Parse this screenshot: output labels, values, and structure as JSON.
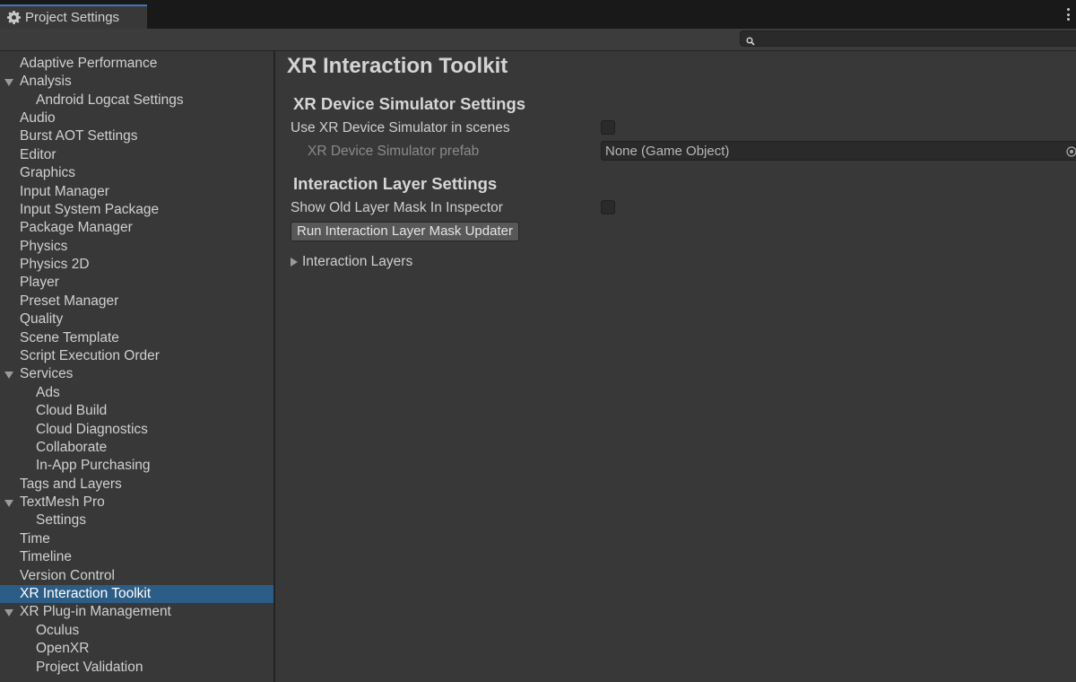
{
  "window": {
    "tab_title": "Project Settings"
  },
  "search": {
    "placeholder": "",
    "value": ""
  },
  "sidebar": {
    "items": [
      {
        "label": "Adaptive Performance",
        "level": 0,
        "expanded": null
      },
      {
        "label": "Analysis",
        "level": 0,
        "expanded": true
      },
      {
        "label": "Android Logcat Settings",
        "level": 1,
        "expanded": null
      },
      {
        "label": "Audio",
        "level": 0,
        "expanded": null
      },
      {
        "label": "Burst AOT Settings",
        "level": 0,
        "expanded": null
      },
      {
        "label": "Editor",
        "level": 0,
        "expanded": null
      },
      {
        "label": "Graphics",
        "level": 0,
        "expanded": null
      },
      {
        "label": "Input Manager",
        "level": 0,
        "expanded": null
      },
      {
        "label": "Input System Package",
        "level": 0,
        "expanded": null
      },
      {
        "label": "Package Manager",
        "level": 0,
        "expanded": null
      },
      {
        "label": "Physics",
        "level": 0,
        "expanded": null
      },
      {
        "label": "Physics 2D",
        "level": 0,
        "expanded": null
      },
      {
        "label": "Player",
        "level": 0,
        "expanded": null
      },
      {
        "label": "Preset Manager",
        "level": 0,
        "expanded": null
      },
      {
        "label": "Quality",
        "level": 0,
        "expanded": null
      },
      {
        "label": "Scene Template",
        "level": 0,
        "expanded": null
      },
      {
        "label": "Script Execution Order",
        "level": 0,
        "expanded": null
      },
      {
        "label": "Services",
        "level": 0,
        "expanded": true
      },
      {
        "label": "Ads",
        "level": 1,
        "expanded": null
      },
      {
        "label": "Cloud Build",
        "level": 1,
        "expanded": null
      },
      {
        "label": "Cloud Diagnostics",
        "level": 1,
        "expanded": null
      },
      {
        "label": "Collaborate",
        "level": 1,
        "expanded": null
      },
      {
        "label": "In-App Purchasing",
        "level": 1,
        "expanded": null
      },
      {
        "label": "Tags and Layers",
        "level": 0,
        "expanded": null
      },
      {
        "label": "TextMesh Pro",
        "level": 0,
        "expanded": true
      },
      {
        "label": "Settings",
        "level": 1,
        "expanded": null
      },
      {
        "label": "Time",
        "level": 0,
        "expanded": null
      },
      {
        "label": "Timeline",
        "level": 0,
        "expanded": null
      },
      {
        "label": "Version Control",
        "level": 0,
        "expanded": null
      },
      {
        "label": "XR Interaction Toolkit",
        "level": 0,
        "expanded": null,
        "selected": true
      },
      {
        "label": "XR Plug-in Management",
        "level": 0,
        "expanded": true
      },
      {
        "label": "Oculus",
        "level": 1,
        "expanded": null
      },
      {
        "label": "OpenXR",
        "level": 1,
        "expanded": null
      },
      {
        "label": "Project Validation",
        "level": 1,
        "expanded": null
      }
    ]
  },
  "main": {
    "title": "XR Interaction Toolkit",
    "device_simulator": {
      "heading": "XR Device Simulator Settings",
      "use_simulator_label": "Use XR Device Simulator in scenes",
      "use_simulator_checked": false,
      "prefab_label": "XR Device Simulator prefab",
      "prefab_value": "None (Game Object)"
    },
    "interaction_layer": {
      "heading": "Interaction Layer Settings",
      "show_old_mask_label": "Show Old Layer Mask In Inspector",
      "show_old_mask_checked": false,
      "updater_button_label": "Run Interaction Layer Mask Updater",
      "layers_foldout_label": "Interaction Layers",
      "layers_foldout_expanded": false
    }
  },
  "colors": {
    "background": "#383838",
    "selection": "#2c5d87",
    "tab_accent": "#3a79bb"
  }
}
